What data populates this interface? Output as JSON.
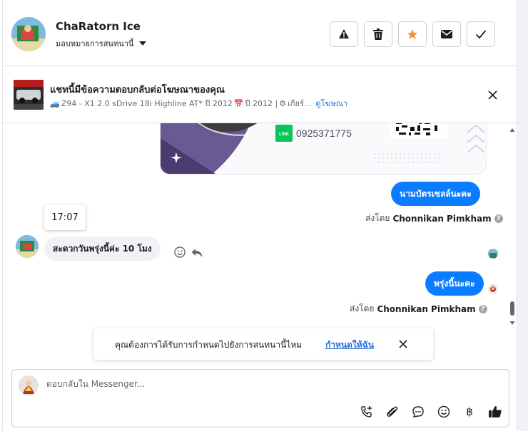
{
  "header": {
    "name": "ChaRatorn Ice",
    "assign_label": "มอบหมายการสนทนานี้",
    "actions": [
      "report",
      "delete",
      "star",
      "mark-unread",
      "done"
    ]
  },
  "ad": {
    "title": "แชทนี้มีข้อความตอบกลับต่อโฆษณาของคุณ",
    "subtitle": "Z94 - X1 2.0 sDrive 18i Highline AT* ปี 2012",
    "year_text": "ปี 2012 |",
    "gear_text": "เกียร์...",
    "link": "ดูโฆษณา"
  },
  "convo": {
    "card_phone": "0925371775",
    "card_line_label": "LINE",
    "msg1": "นามบัตรเซลล์นะคะ",
    "sentby1_prefix": "ส่งโดย",
    "sentby1_name": "Chonnikan Pimkham",
    "tooltip_time": "17:07",
    "msg_in": "สะดวกวันพรุ่งนี้ค่ะ 10 โมง",
    "msg2": "พรุ่งนี้นะคะ",
    "sentby2_prefix": "ส่งโดย",
    "sentby2_name": "Chonnikan Pimkham"
  },
  "suggest": {
    "text": "คุณต้องการได้รับการกำหนดไปยังการสนทนานี้ไหม",
    "link": "กำหนดให้ฉัน"
  },
  "composer": {
    "placeholder": "ตอบกลับใน Messenger...",
    "tools": [
      "call-icon",
      "attach-icon",
      "chat-icon",
      "emoji-icon",
      "baht-icon",
      "like-icon"
    ],
    "baht_glyph": "฿"
  },
  "colors": {
    "accent": "#0a7cff",
    "link": "#216fdb",
    "star": "#f7923b"
  }
}
